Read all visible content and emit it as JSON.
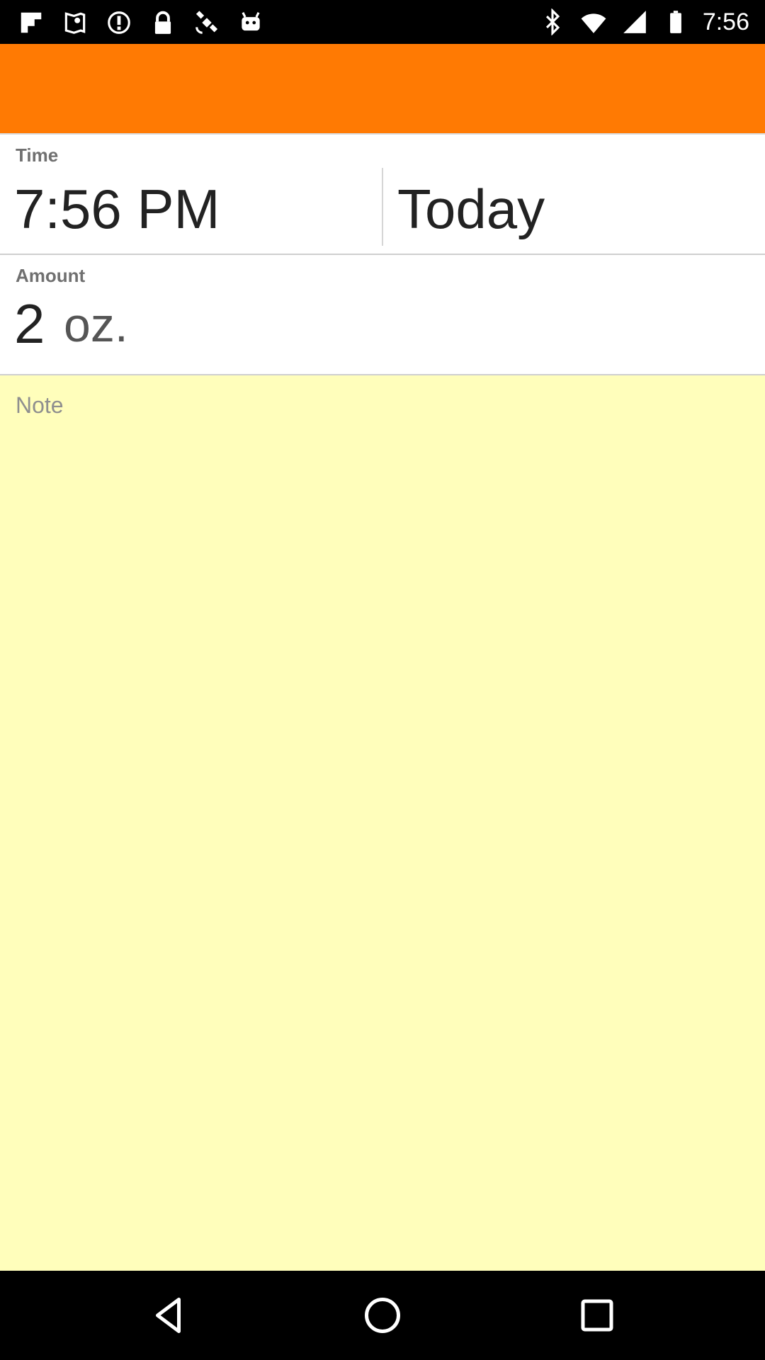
{
  "status_bar": {
    "time": "7:56",
    "left_icons": [
      "flipboard-icon",
      "maps-icon",
      "alert-icon",
      "lock-icon",
      "satellite-icon",
      "android-icon"
    ],
    "right_icons": [
      "bluetooth-icon",
      "wifi-icon",
      "signal-icon",
      "battery-icon"
    ]
  },
  "app_bar": {
    "color": "#ff7a03"
  },
  "time_section": {
    "label": "Time",
    "time_value": "7:56 PM",
    "date_value": "Today"
  },
  "amount_section": {
    "label": "Amount",
    "value": "2",
    "unit": "oz."
  },
  "note": {
    "placeholder": "Note",
    "background": "#fffebb"
  },
  "nav_bar": {
    "buttons": [
      "back-icon",
      "home-icon",
      "recents-icon"
    ]
  }
}
